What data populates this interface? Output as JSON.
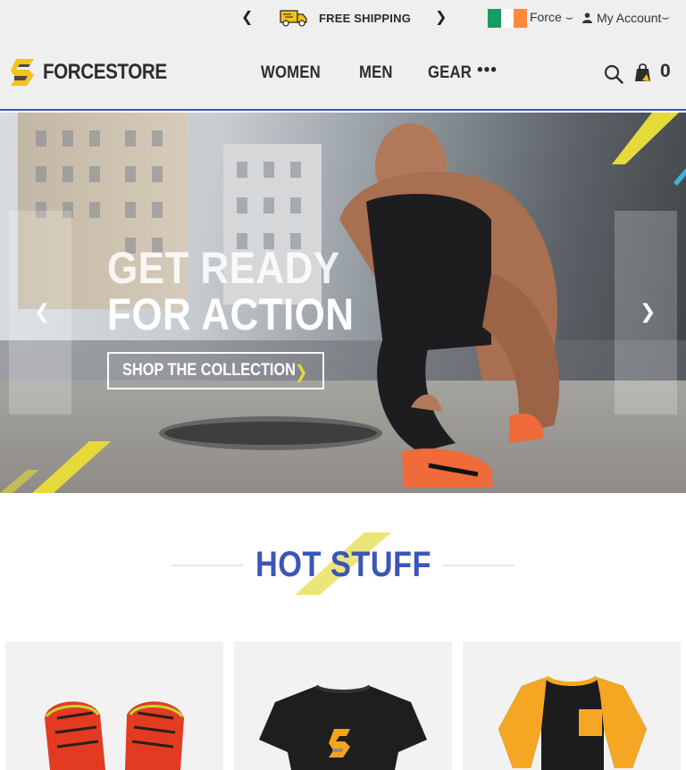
{
  "topbar": {
    "promo_text": "FREE SHIPPING",
    "prev_arrow": "❮",
    "next_arrow": "❯",
    "country_label": "Force",
    "account_label": "My Account",
    "dropdown_caret": "⌣",
    "flag_colors": [
      "#169b62",
      "#ffffff",
      "#ff883e"
    ]
  },
  "header": {
    "brand": "FORCESTORE",
    "nav": [
      "WOMEN",
      "MEN",
      "GEAR"
    ],
    "more": "•••",
    "cart_count": "0",
    "accent_color": "#3b55b8",
    "brand_yellow": "#f2c318"
  },
  "hero": {
    "headline_1": "GET READY",
    "headline_2": "FOR ACTION",
    "cta_label": "SHOP THE COLLECTION",
    "cta_chevron": "❯",
    "prev": "❮",
    "next": "❯"
  },
  "section": {
    "title": "HOT STUFF"
  },
  "products": [
    {
      "name": "red-trail-shoes"
    },
    {
      "name": "black-logo-tshirt"
    },
    {
      "name": "orange-raglan-shirt"
    }
  ]
}
